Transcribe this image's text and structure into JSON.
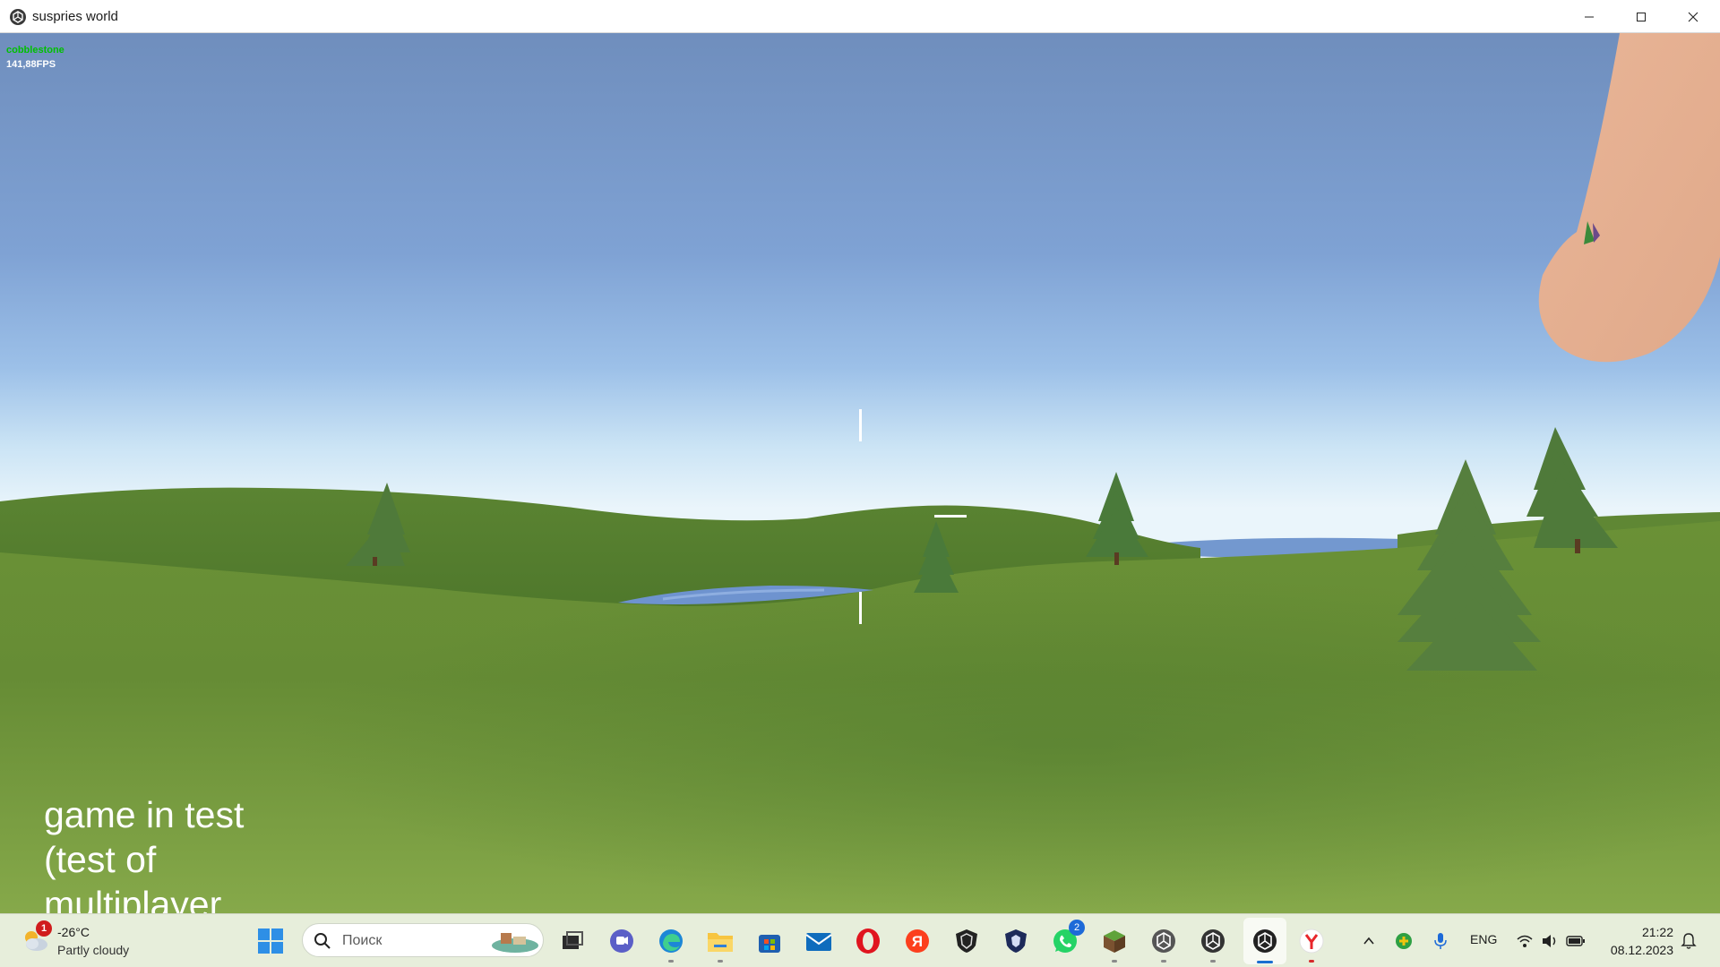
{
  "window": {
    "title": "suspries world"
  },
  "hud": {
    "selected_block": "cobblestone",
    "fps": "141,88FPS"
  },
  "game": {
    "caption": "game in test\n(test of\nmultiplayer"
  },
  "taskbar": {
    "weather": {
      "badge": "1",
      "temperature": "-26°C",
      "condition": "Partly cloudy"
    },
    "search": {
      "placeholder": "Поиск"
    },
    "apps": [
      {
        "name": "task-view",
        "badge": ""
      },
      {
        "name": "teams-chat",
        "badge": ""
      },
      {
        "name": "edge",
        "badge": ""
      },
      {
        "name": "file-explorer",
        "badge": ""
      },
      {
        "name": "microsoft-store",
        "badge": ""
      },
      {
        "name": "mail",
        "badge": ""
      },
      {
        "name": "opera",
        "badge": ""
      },
      {
        "name": "yandex",
        "badge": ""
      },
      {
        "name": "shield-app-1",
        "badge": ""
      },
      {
        "name": "shield-app-2",
        "badge": ""
      },
      {
        "name": "whatsapp",
        "badge": "2"
      },
      {
        "name": "minecraft",
        "badge": ""
      },
      {
        "name": "unity-1",
        "badge": ""
      },
      {
        "name": "unity-2",
        "badge": ""
      },
      {
        "name": "unity-3",
        "badge": ""
      },
      {
        "name": "yandex-browser",
        "badge": ""
      }
    ],
    "tray": {
      "language": "ENG"
    },
    "clock": {
      "time": "21:22",
      "date": "08.12.2023"
    }
  },
  "colors": {
    "sky_top": "#6f8ebd",
    "sky_horizon": "#e6f3fb",
    "grass_far": "#4f7a2d",
    "grass_near": "#7ea141",
    "water": "#6e93cf",
    "tree": "#4f7a3a",
    "hand": "#e6b294",
    "taskbar_bg": "#e7eedb",
    "hud_green": "#00c000"
  }
}
